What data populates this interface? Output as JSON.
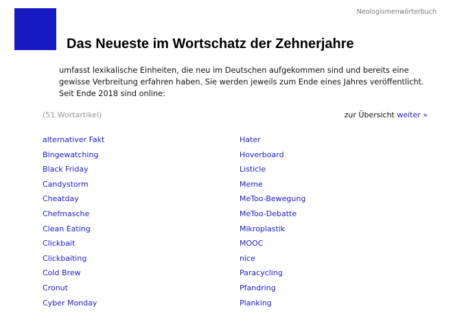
{
  "header": {
    "site_name": "Neologismenwörterbuch",
    "logo_color": "#1719c5",
    "title": "Das Neueste im Wortschatz der Zehnerjahre"
  },
  "intro": "umfasst lexikalische Einheiten, die neu im Deutschen aufgekommen sind und bereits eine gewisse Verbreitung erfahren haben. Sie werden jeweils zum Ende eines Jahres veröffentlicht. Seit Ende 2018 sind online:",
  "listing": {
    "count": "(51 Wortartikel)",
    "overview_text": "zur Übersicht",
    "more_link": "weiter »"
  },
  "words_left": [
    "alternativer Fakt",
    "Bingewatching",
    "Black Friday",
    "Candystorm",
    "Cheatday",
    "Chefmasche",
    "Clean Eating",
    "Clickbait",
    "Clickbaiting",
    "Cold Brew",
    "Cronut",
    "Cyber Monday"
  ],
  "words_right": [
    "Hater",
    "Hoverboard",
    "Listicle",
    "Meme",
    "MeToo-Bewegung",
    "MeToo-Debatte",
    "Mikroplastik",
    "MOOC",
    "nice",
    "Paracycling",
    "Pfandring",
    "Planking"
  ]
}
